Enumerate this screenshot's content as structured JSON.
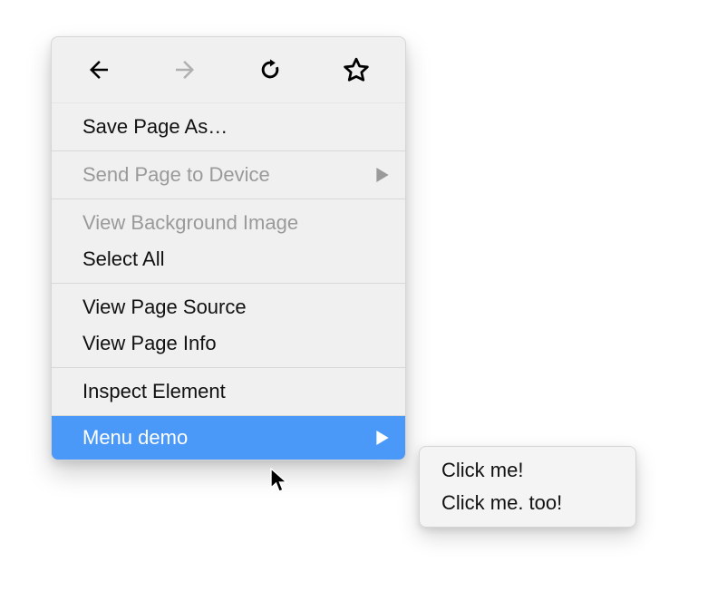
{
  "toolbar": {
    "back_icon": "back-arrow-icon",
    "forward_icon": "forward-arrow-icon",
    "reload_icon": "reload-icon",
    "bookmark_icon": "star-icon",
    "forward_disabled_color": "#b0b0b0"
  },
  "menu": {
    "save_page_as": "Save Page As…",
    "send_page_to_device": "Send Page to Device",
    "view_background_image": "View Background Image",
    "select_all": "Select All",
    "view_page_source": "View Page Source",
    "view_page_info": "View Page Info",
    "inspect_element": "Inspect Element",
    "menu_demo": "Menu demo"
  },
  "submenu": {
    "click_me": "Click me!",
    "click_me_too": "Click me. too!"
  },
  "colors": {
    "highlight": "#4a98f7",
    "menu_bg": "#f0f0f0",
    "disabled_text": "#9a9a9a"
  }
}
